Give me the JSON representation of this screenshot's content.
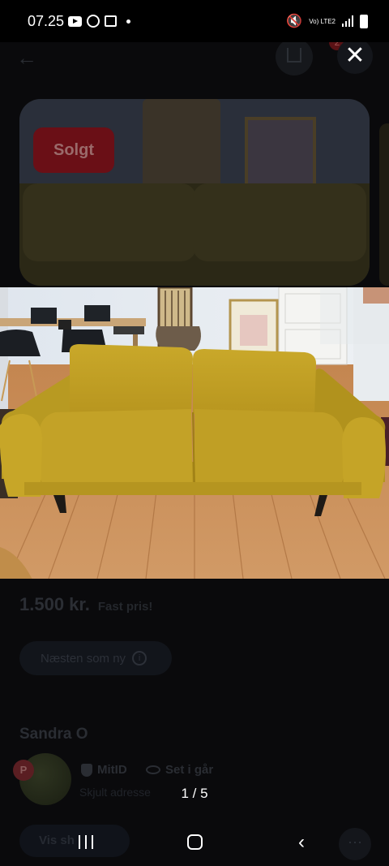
{
  "status_bar": {
    "time": "07.25",
    "network_label": "Vo) LTE2"
  },
  "listing": {
    "sold_label": "Solgt",
    "price": "1.500 kr.",
    "price_note": "Fast pris!",
    "condition": "Næsten som ny",
    "seller_name": "Sandra O",
    "seller_initial": "P",
    "verified_label": "MitID",
    "last_seen": "Set i går",
    "address": "Skjult adresse",
    "show_button": "Vis sh",
    "favorites_count": "2"
  },
  "viewer": {
    "pager": "1 / 5"
  },
  "icons": {
    "back": "back-arrow-icon",
    "share": "share-icon",
    "close": "close-icon",
    "info": "info-icon",
    "shield": "shield-icon",
    "eye": "eye-icon"
  },
  "colors": {
    "sofa_yellow": "#c9a82a",
    "sold_red": "#e0232e",
    "floor_wood": "#c98a52"
  }
}
